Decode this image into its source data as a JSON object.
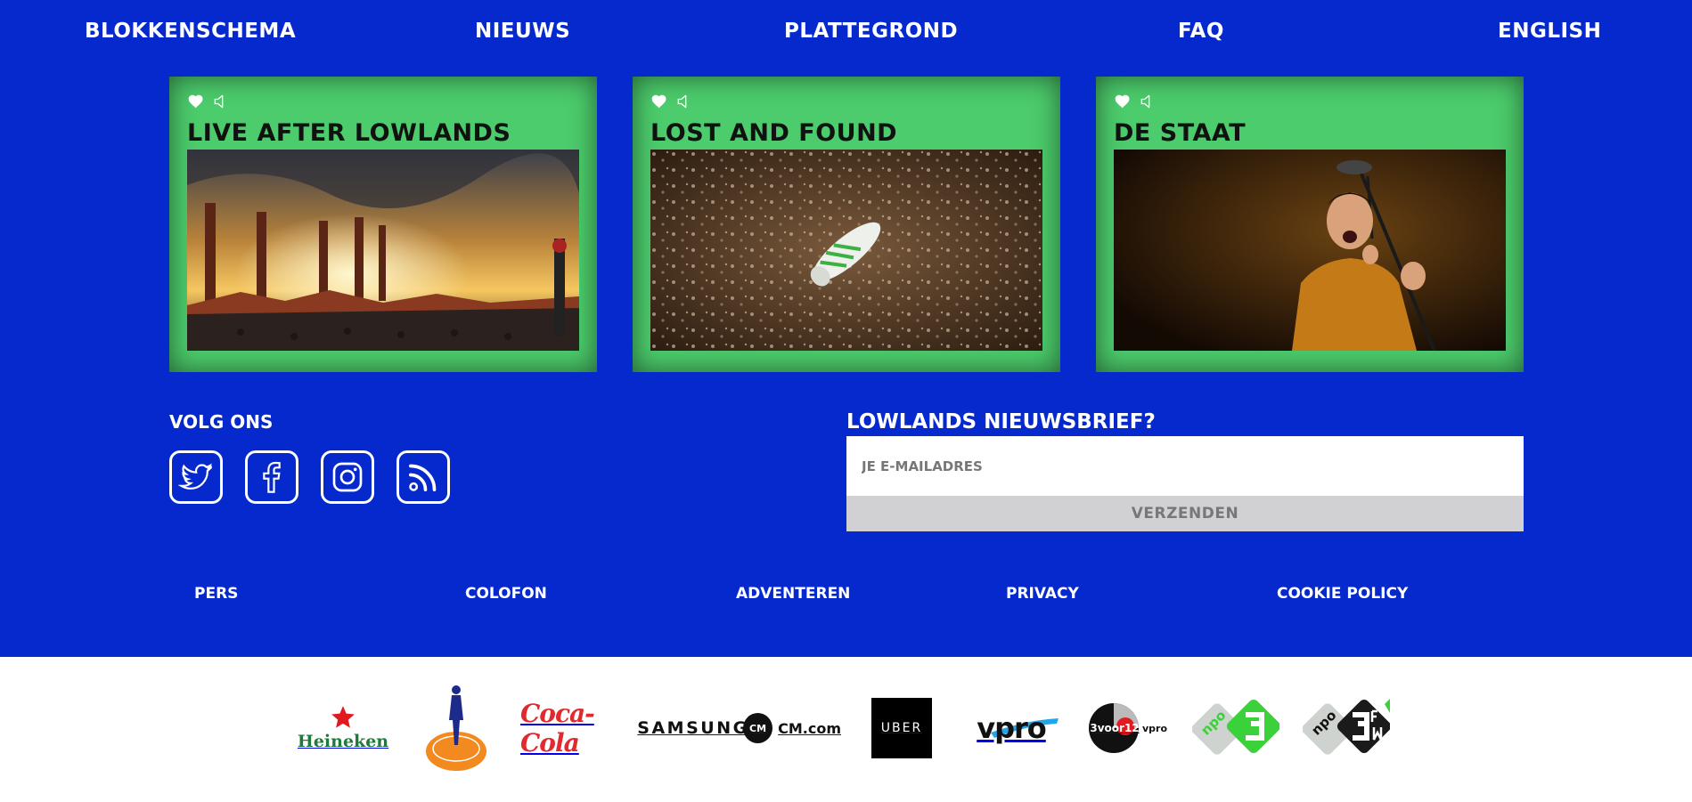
{
  "nav": {
    "items": [
      "BLOKKENSCHEMA",
      "NIEUWS",
      "PLATTEGROND",
      "FAQ",
      "ENGLISH"
    ]
  },
  "cards": [
    {
      "title": "LIVE AFTER LOWLANDS"
    },
    {
      "title": "LOST AND FOUND"
    },
    {
      "title": "DE STAAT"
    }
  ],
  "social": {
    "title": "VOLG ONS",
    "icons": [
      "twitter-icon",
      "facebook-icon",
      "instagram-icon",
      "rss-icon"
    ]
  },
  "newsletter": {
    "title": "LOWLANDS NIEUWSBRIEF?",
    "placeholder": "JE E-MAILADRES",
    "submit": "VERZENDEN"
  },
  "footer": {
    "links": [
      "PERS",
      "COLOFON",
      "ADVENTEREN",
      "PRIVACY",
      "COOKIE POLICY"
    ]
  },
  "sponsors": {
    "heineken": "Heineken",
    "cocacola": "Coca-Cola",
    "samsung": "SAMSUNG",
    "cm": "CM.com",
    "cm_badge": "CM",
    "uber": "UBER",
    "vpro": "vpro",
    "threevoor12": "3voor12",
    "threevoor12_vpro": "vpro",
    "npo": "npo"
  },
  "colors": {
    "background": "#0529cc",
    "card": "#4ccc6c",
    "input_bg": "#ffffff",
    "button_bg": "#d1d1d3"
  }
}
